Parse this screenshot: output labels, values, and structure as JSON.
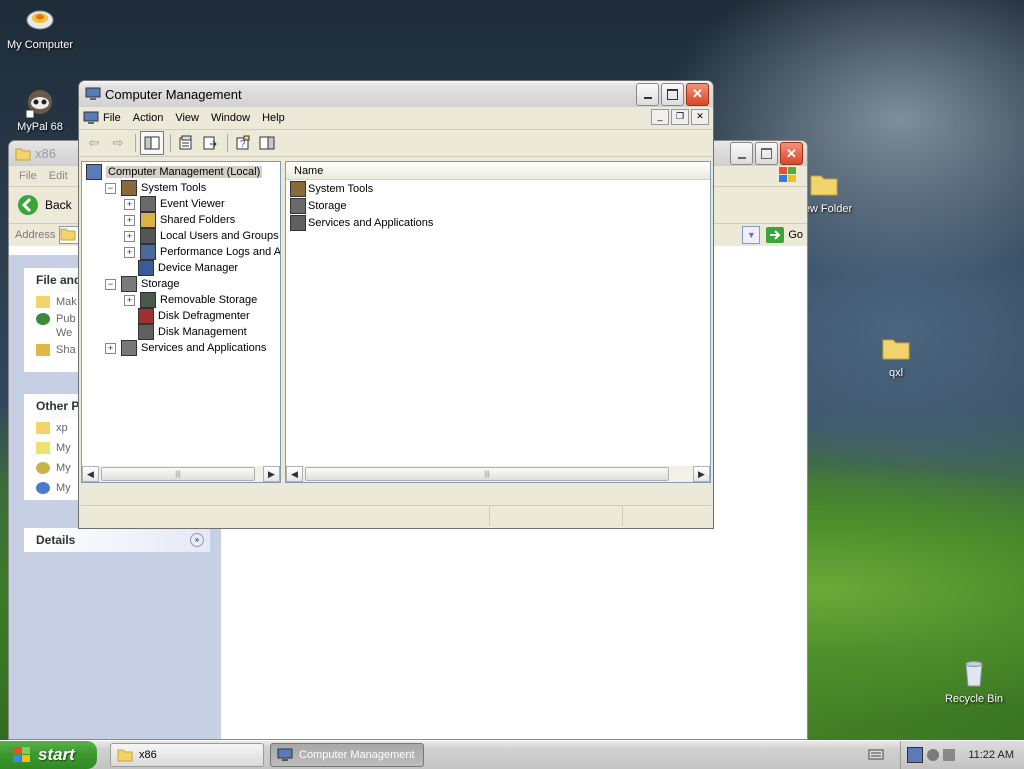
{
  "desktop": {
    "icons": [
      {
        "label": "My Computer"
      },
      {
        "label": "MyPal 68"
      },
      {
        "label": "New Folder"
      },
      {
        "label": "qxl"
      },
      {
        "label": "Recycle Bin"
      }
    ]
  },
  "explorer": {
    "title": "x86",
    "menu": [
      "File",
      "Edit"
    ],
    "back_label": "Back",
    "address_label": "Address",
    "go_label": "Go",
    "task_pane": {
      "file_tasks_header": "File and",
      "file_tasks": [
        "Mak",
        "Pub",
        "We",
        "Sha"
      ],
      "other_places_header": "Other P",
      "other_places": [
        "xp",
        "My",
        "My",
        "My"
      ],
      "details_header": "Details"
    }
  },
  "cm": {
    "title": "Computer Management",
    "menu": [
      "File",
      "Action",
      "View",
      "Window",
      "Help"
    ],
    "tree": [
      {
        "label": "Computer Management (Local)",
        "level": 0,
        "expander": "",
        "selected": true
      },
      {
        "label": "System Tools",
        "level": 1,
        "expander": "−"
      },
      {
        "label": "Event Viewer",
        "level": 2,
        "expander": "+"
      },
      {
        "label": "Shared Folders",
        "level": 2,
        "expander": "+"
      },
      {
        "label": "Local Users and Groups",
        "level": 2,
        "expander": "+"
      },
      {
        "label": "Performance Logs and Alerts",
        "level": 2,
        "expander": "+"
      },
      {
        "label": "Device Manager",
        "level": 2,
        "expander": ""
      },
      {
        "label": "Storage",
        "level": 1,
        "expander": "−"
      },
      {
        "label": "Removable Storage",
        "level": 2,
        "expander": "+"
      },
      {
        "label": "Disk Defragmenter",
        "level": 2,
        "expander": ""
      },
      {
        "label": "Disk Management",
        "level": 2,
        "expander": ""
      },
      {
        "label": "Services and Applications",
        "level": 1,
        "expander": "+"
      }
    ],
    "list_header": "Name",
    "list_items": [
      "System Tools",
      "Storage",
      "Services and Applications"
    ]
  },
  "taskbar": {
    "start_label": "start",
    "buttons": [
      {
        "label": "x86",
        "active": false
      },
      {
        "label": "Computer Management",
        "active": true
      }
    ],
    "clock": "11:22 AM"
  }
}
